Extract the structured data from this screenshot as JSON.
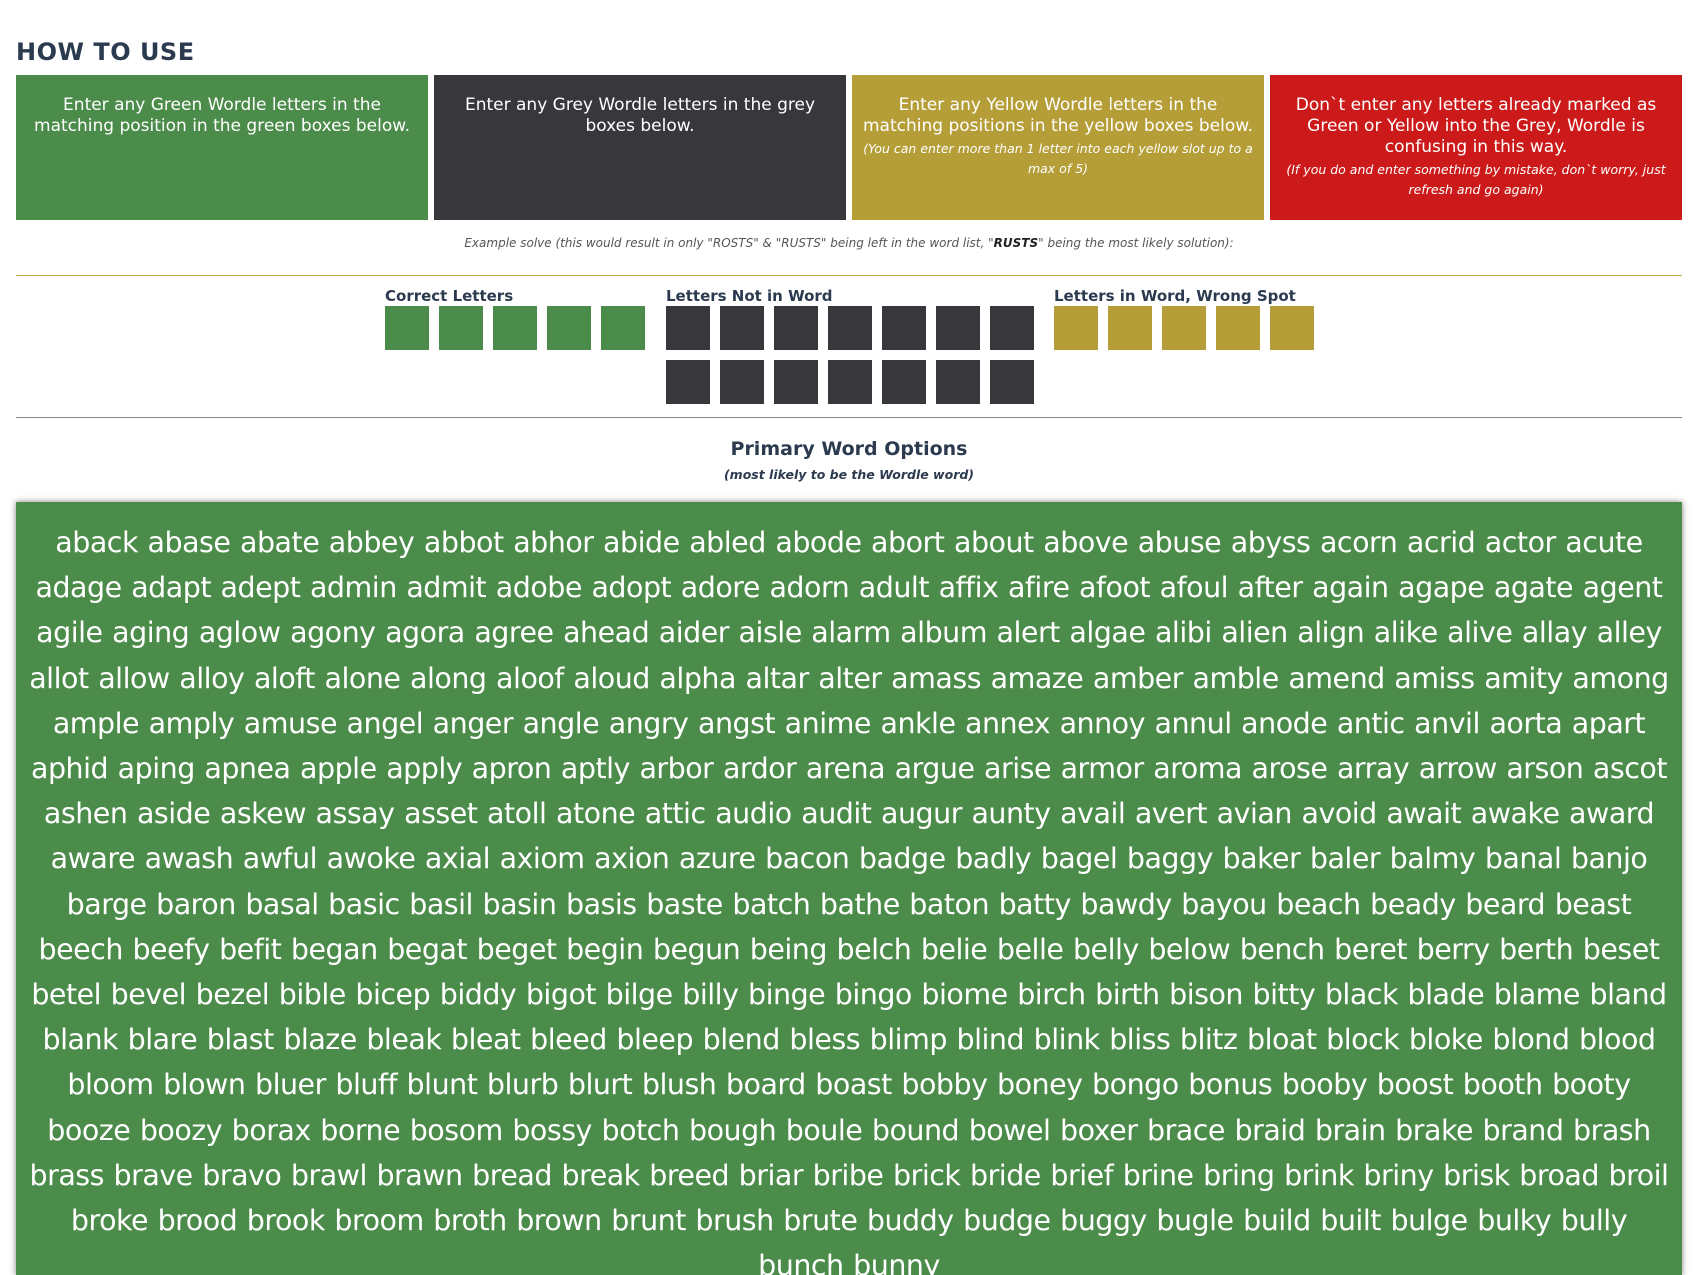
{
  "how_to_use": {
    "title": "HOW TO USE",
    "cards": [
      {
        "text": "Enter any Green Wordle letters in the matching position in the green boxes below.",
        "note": ""
      },
      {
        "text": "Enter any Grey Wordle letters in the grey boxes below.",
        "note": ""
      },
      {
        "text": "Enter any Yellow Wordle letters in the matching positions in the yellow boxes below.",
        "note": "(You can enter more than 1 letter into each yellow slot up to a max of 5)"
      },
      {
        "text": "Don`t enter any letters already marked as Green or Yellow into the Grey, Wordle is confusing in this way.",
        "note": "(If you do and enter something by mistake, don`t worry, just refresh and go again)"
      }
    ],
    "example_prefix": "Example solve (this would result in only \"ROSTS\" & \"RUSTS\" being left in the word list, \"",
    "example_bold": "RUSTS",
    "example_suffix": "\" being the most likely solution):"
  },
  "inputs": {
    "correct_label": "Correct Letters",
    "not_in_word_label": "Letters Not in Word",
    "wrong_spot_label": "Letters in Word, Wrong Spot"
  },
  "primary": {
    "title": "Primary Word Options",
    "subtitle": "(most likely to be the Wordle word)",
    "words": "aback abase abate abbey abbot abhor abide abled abode abort about above abuse abyss acorn acrid actor acute adage adapt adept admin admit adobe adopt adore adorn adult affix afire afoot afoul after again agape agate agent agile aging aglow agony agora agree ahead aider aisle alarm album alert algae alibi alien align alike alive allay alley allot allow alloy aloft alone along aloof aloud alpha altar alter amass amaze amber amble amend amiss amity among ample amply amuse angel anger angle angry angst anime ankle annex annoy annul anode antic anvil aorta apart aphid aping apnea apple apply apron aptly arbor ardor arena argue arise armor aroma arose array arrow arson ascot ashen aside askew assay asset atoll atone attic audio audit augur aunty avail avert avian avoid await awake award aware awash awful awoke axial axiom axion azure bacon badge badly bagel baggy baker baler balmy banal banjo barge baron basal basic basil basin basis baste batch bathe baton batty bawdy bayou beach beady beard beast beech beefy befit began begat beget begin begun being belch belie belle belly below bench beret berry berth beset betel bevel bezel bible bicep biddy bigot bilge billy binge bingo biome birch birth bison bitty black blade blame bland blank blare blast blaze bleak bleat bleed bleep blend bless blimp blind blink bliss blitz bloat block bloke blond blood bloom blown bluer bluff blunt blurb blurt blush board boast bobby boney bongo bonus booby boost booth booty booze boozy borax borne bosom bossy botch bough boule bound bowel boxer brace braid brain brake brand brash brass brave bravo brawl brawn bread break breed briar bribe brick bride brief brine bring brink briny brisk broad broil broke brood brook broom broth brown brunt brush brute buddy budge buggy bugle build built bulge bulky bully bunch bunny"
  },
  "colors": {
    "green": "#4c8c4a",
    "grey": "#38383c",
    "yellow": "#b59e38",
    "red": "#cc1a1a"
  }
}
